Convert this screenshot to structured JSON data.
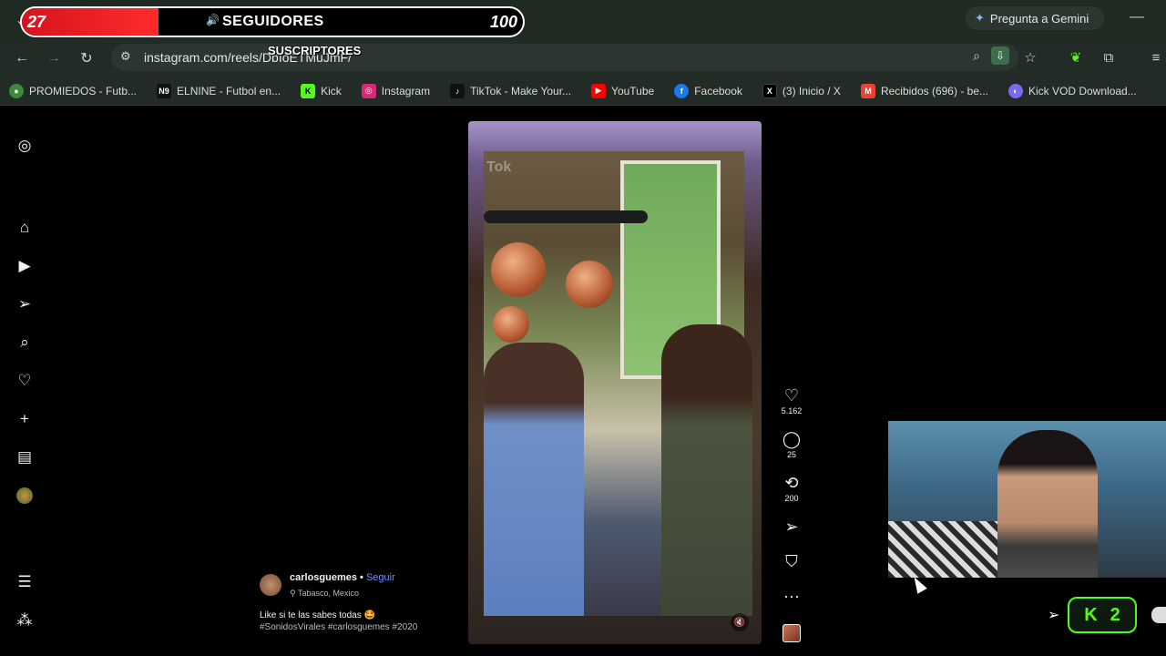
{
  "overlay": {
    "count": "27",
    "title": "SEGUIDORES",
    "goal": "100",
    "subtitle": "SUSCRIPTORES"
  },
  "browser": {
    "url": "instagram.com/reels/DbIoETMuJmF/",
    "gemini_label": "Pregunta a Gemini"
  },
  "bookmarks": [
    {
      "label": "PROMIEDOS - Futb...",
      "color": "#3a8a3a",
      "icon": "soccer-icon"
    },
    {
      "label": "ELNINE - Futbol en...",
      "color": "#111111",
      "icon": "n9-icon"
    },
    {
      "label": "Kick",
      "color": "#53fc18",
      "icon": "kick-icon"
    },
    {
      "label": "Instagram",
      "color": "#d6297a",
      "icon": "instagram-icon"
    },
    {
      "label": "TikTok - Make Your...",
      "color": "#111111",
      "icon": "tiktok-icon"
    },
    {
      "label": "YouTube",
      "color": "#ff0000",
      "icon": "youtube-icon"
    },
    {
      "label": "Facebook",
      "color": "#1877f2",
      "icon": "facebook-icon"
    },
    {
      "label": "(3) Inicio / X",
      "color": "#000000",
      "icon": "x-icon"
    },
    {
      "label": "Recibidos (696) - be...",
      "color": "#ea4335",
      "icon": "gmail-icon"
    },
    {
      "label": "Kick VOD Download...",
      "color": "#7a6af0",
      "icon": "vod-icon"
    }
  ],
  "reel": {
    "likes": "5.162",
    "comments": "25",
    "reposts": "200",
    "watermark": "Tok",
    "username": "carlosguemes",
    "follow": "Seguir",
    "separator": " • ",
    "location": "Tabasco, Mexico",
    "caption": "Like si te las sabes todas 🤩",
    "tags": "#SonidosVirales #carlosguemes #2020"
  },
  "kick": {
    "logo": "K",
    "count": "2"
  }
}
